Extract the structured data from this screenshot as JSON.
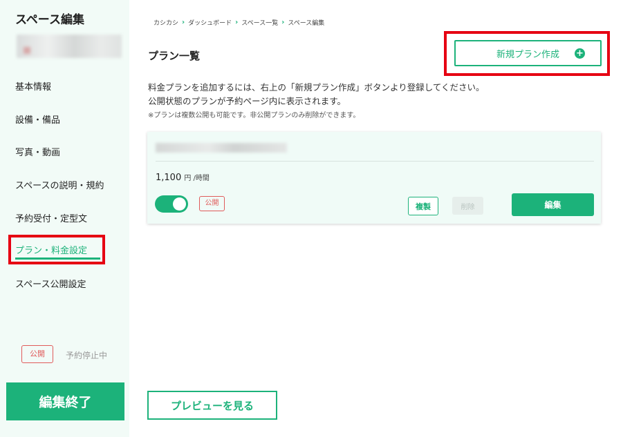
{
  "sidebar": {
    "title": "スペース編集",
    "nav_items": [
      {
        "label": "基本情報"
      },
      {
        "label": "設備・備品"
      },
      {
        "label": "写真・動画"
      },
      {
        "label": "スペースの説明・規約"
      },
      {
        "label": "予約受付・定型文"
      },
      {
        "label": "プラン・料金設定",
        "active": true
      },
      {
        "label": "スペース公開設定"
      }
    ],
    "status_badge": "公開",
    "booking_status": "予約停止中",
    "finish_button": "編集終了"
  },
  "breadcrumb": [
    "カシカシ",
    "ダッシュボード",
    "スペース一覧",
    "スペース編集"
  ],
  "main": {
    "title": "プラン一覧",
    "new_plan_button": "新規プラン作成",
    "description_line1": "料金プランを追加するには、右上の「新規プラン作成」ボタンより登録してください。",
    "description_line2": "公開状態のプランが予約ページ内に表示されます。",
    "note": "※プランは複数公開も可能です。非公開プランのみ削除ができます。",
    "plan_card": {
      "price": "1,100",
      "price_unit": "円 /時間",
      "toggle_on": true,
      "status_badge": "公開",
      "copy_button": "複製",
      "delete_button": "削除",
      "edit_button": "編集"
    },
    "preview_button": "プレビューを見る"
  },
  "colors": {
    "accent": "#1cb27a",
    "highlight": "#e60012",
    "badge": "#e05a5a",
    "sidebar_bg": "#f2fbf7",
    "card_bg": "#f0fbf7"
  },
  "icons": [
    "chevron-right-icon",
    "plus-circle-icon"
  ]
}
